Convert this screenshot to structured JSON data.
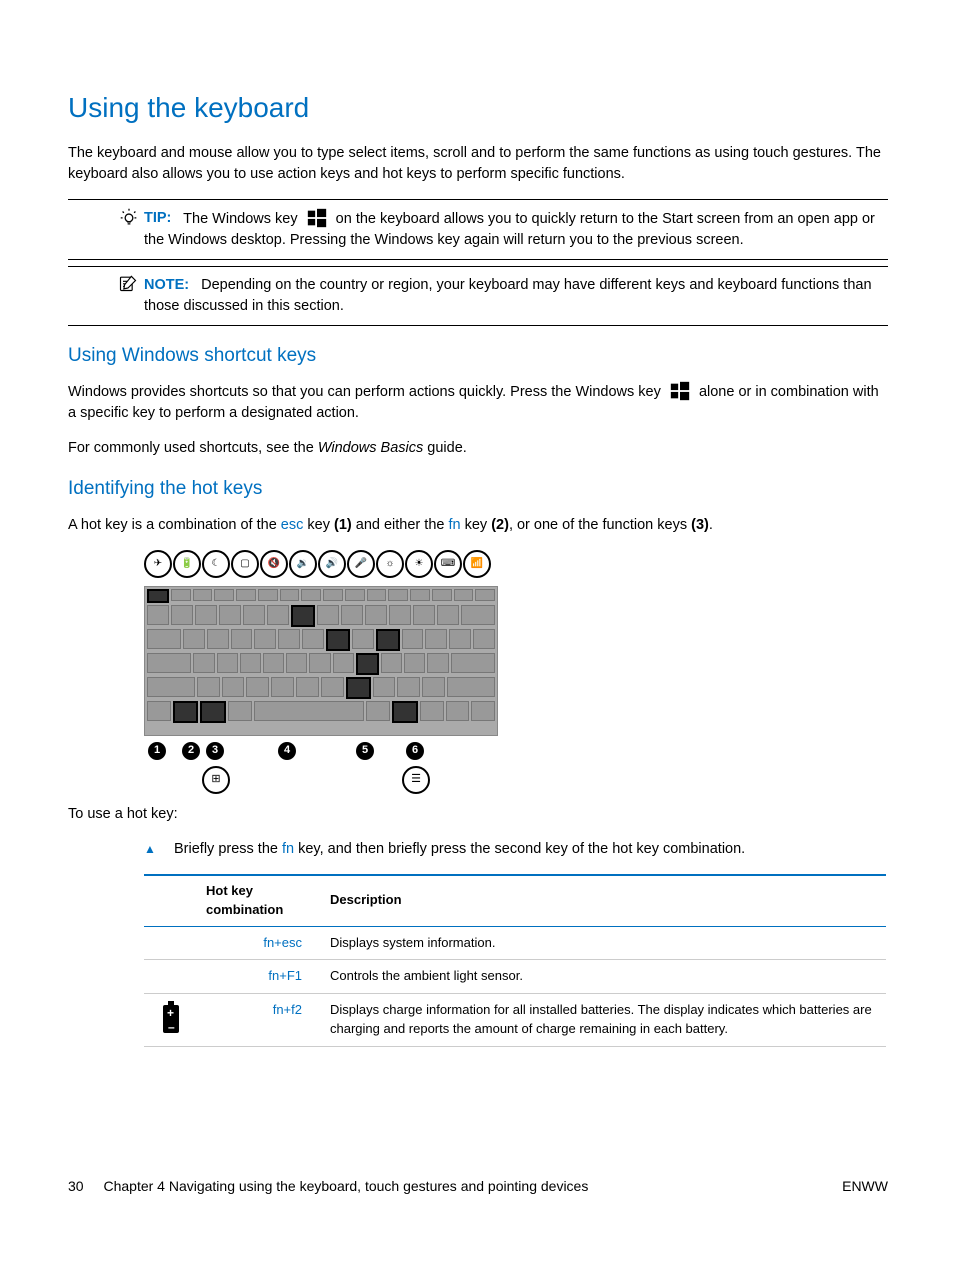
{
  "h1": "Using the keyboard",
  "intro": "The keyboard and mouse allow you to type select items, scroll and to perform the same functions as using touch gestures. The keyboard also allows you to use action keys and hot keys to perform specific functions.",
  "tip": {
    "label": "TIP:",
    "before_icon": "The Windows key",
    "after_icon": "on the keyboard allows you to quickly return to the Start screen from an open app or the Windows desktop. Pressing the Windows key again will return you to the previous screen."
  },
  "note": {
    "label": "NOTE:",
    "text": "Depending on the country or region, your keyboard may have different keys and keyboard functions than those discussed in this section."
  },
  "h2a": "Using Windows shortcut keys",
  "shortcut_para_before": "Windows provides shortcuts so that you can perform actions quickly. Press the Windows key",
  "shortcut_para_after": "alone or in combination with a specific key to perform a designated action.",
  "shortcut_see_before": "For commonly used shortcuts, see the ",
  "shortcut_see_guide": "Windows Basics",
  "shortcut_see_after": " guide.",
  "h2b": "Identifying the hot keys",
  "hotkey_intro_a": "A hot key is a combination of the ",
  "hotkey_esc": "esc",
  "hotkey_intro_b": " key ",
  "hotkey_b1": "(1)",
  "hotkey_intro_c": " and either the ",
  "hotkey_fn": "fn",
  "hotkey_intro_d": " key ",
  "hotkey_b2": "(2)",
  "hotkey_intro_e": ", or one of the function keys ",
  "hotkey_b3": "(3)",
  "hotkey_intro_f": ".",
  "to_use": "To use a hot key:",
  "step_a": "Briefly press the ",
  "step_fn": "fn",
  "step_b": " key, and then briefly press the second key of the hot key combination.",
  "table": {
    "h1": "Hot key combination",
    "h2": "Description",
    "rows": [
      {
        "icon": "",
        "combo": "fn+esc",
        "desc": "Displays system information."
      },
      {
        "icon": "",
        "combo": "fn+F1",
        "desc": "Controls the ambient light sensor."
      },
      {
        "icon": "battery",
        "combo": "fn+f2",
        "desc": "Displays charge information for all installed batteries. The display indicates which batteries are charging and reports the amount of charge remaining in each battery."
      }
    ]
  },
  "footer": {
    "page": "30",
    "chapter": "Chapter 4   Navigating using the keyboard, touch gestures and pointing devices",
    "right": "ENWW"
  },
  "callouts": [
    "1",
    "2",
    "3",
    "4",
    "5",
    "6"
  ]
}
